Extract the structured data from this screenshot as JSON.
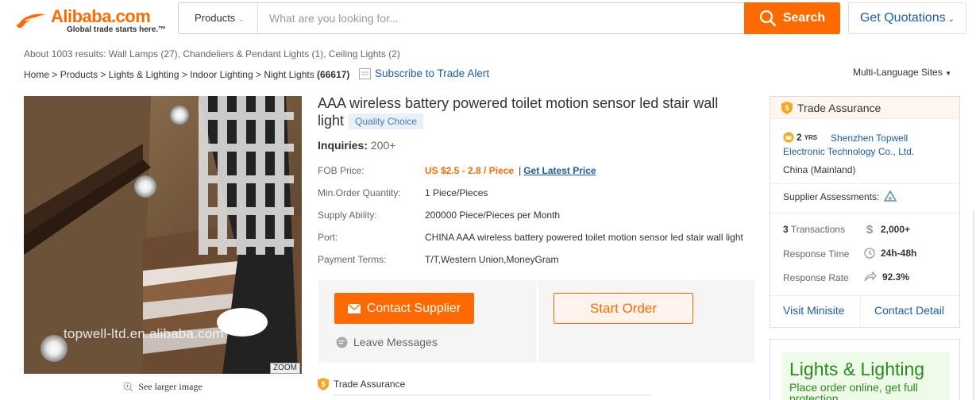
{
  "header": {
    "logo_text": "Alibaba.com",
    "logo_tagline": "Global trade starts here.™",
    "search_category": "Products",
    "search_placeholder": "What are you looking for...",
    "search_button": "Search",
    "quotations_button": "Get Quotations"
  },
  "results": {
    "prefix": "About 1003 results:",
    "links": [
      "Wall Lamps (27)",
      "Chandeliers & Pendant Lights (1)",
      "Ceiling Lights (2)"
    ]
  },
  "breadcrumb": {
    "items": [
      "Home",
      "Products",
      "Lights & Lighting",
      "Indoor Lighting",
      "Night Lights"
    ],
    "count": "(66617)",
    "separator": ">"
  },
  "subscribe_label": "Subscribe to Trade Alert",
  "multi_language": "Multi-Language Sites",
  "image": {
    "watermark": "topwell-ltd.en.alibaba.com",
    "zoom_label": "ZOOM",
    "see_larger": "See larger image"
  },
  "product": {
    "title": "AAA wireless battery powered toilet motion sensor led stair wall light",
    "badge": "Quality Choice",
    "inquiries_label": "Inquiries:",
    "inquiries_value": "200+",
    "fob_label": "FOB Price:",
    "fob_value": "US $2.5 - 2.8 / Piece",
    "latest_price": "Get Latest Price",
    "moq_label": "Min.Order Quantity:",
    "moq_value": "1 Piece/Pieces",
    "supply_label": "Supply Ability:",
    "supply_value": "200000 Piece/Pieces per Month",
    "port_label": "Port:",
    "port_value": "CHINA AAA wireless battery powered toilet motion sensor led stair wall light",
    "payment_label": "Payment Terms:",
    "payment_value": "T/T,Western Union,MoneyGram"
  },
  "actions": {
    "contact": "Contact Supplier",
    "start_order": "Start Order",
    "leave_messages": "Leave Messages",
    "trade_assurance": "Trade Assurance"
  },
  "supplier": {
    "header": "Trade Assurance",
    "years": "2",
    "years_unit": "YRS",
    "company": "Shenzhen Topwell Electronic Technology Co., Ltd.",
    "country": "China (Mainland)",
    "assessments": "Supplier Assessments:",
    "transactions_count": "3",
    "transactions_label": "Transactions",
    "transactions_value": "2,000+",
    "response_time_label": "Response Time",
    "response_time_value": "24h-48h",
    "response_rate_label": "Response Rate",
    "response_rate_value": "92.3%",
    "visit_minisite": "Visit Minisite",
    "contact_detail": "Contact Detail"
  },
  "banner": {
    "title": "Lights & Lighting",
    "subtitle": "Place order online, get full protection"
  },
  "colors": {
    "brand_orange": "#ff6a00",
    "link_blue": "#1a5ea8",
    "banner_green": "#2b8a1e"
  }
}
